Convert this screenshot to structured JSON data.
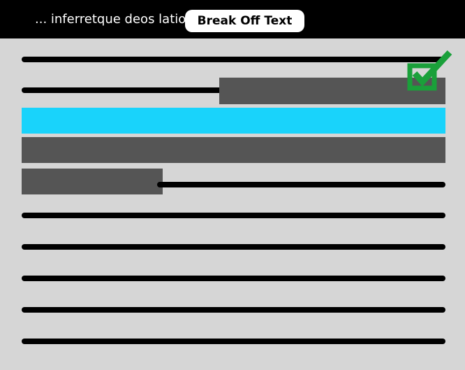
{
  "header": {
    "truncated_text": "... inferretque deos latio",
    "break_off_button_label": "Break Off Text"
  },
  "icons": {
    "selection_marker": "checkmark-in-box-icon"
  },
  "colors": {
    "header_background": "#000000",
    "page_background": "#d6d6d6",
    "text_line": "#000000",
    "highlight_selection": "#19d3fb",
    "redacted_block": "#555555",
    "checkmark_accent": "#1aa03a"
  }
}
